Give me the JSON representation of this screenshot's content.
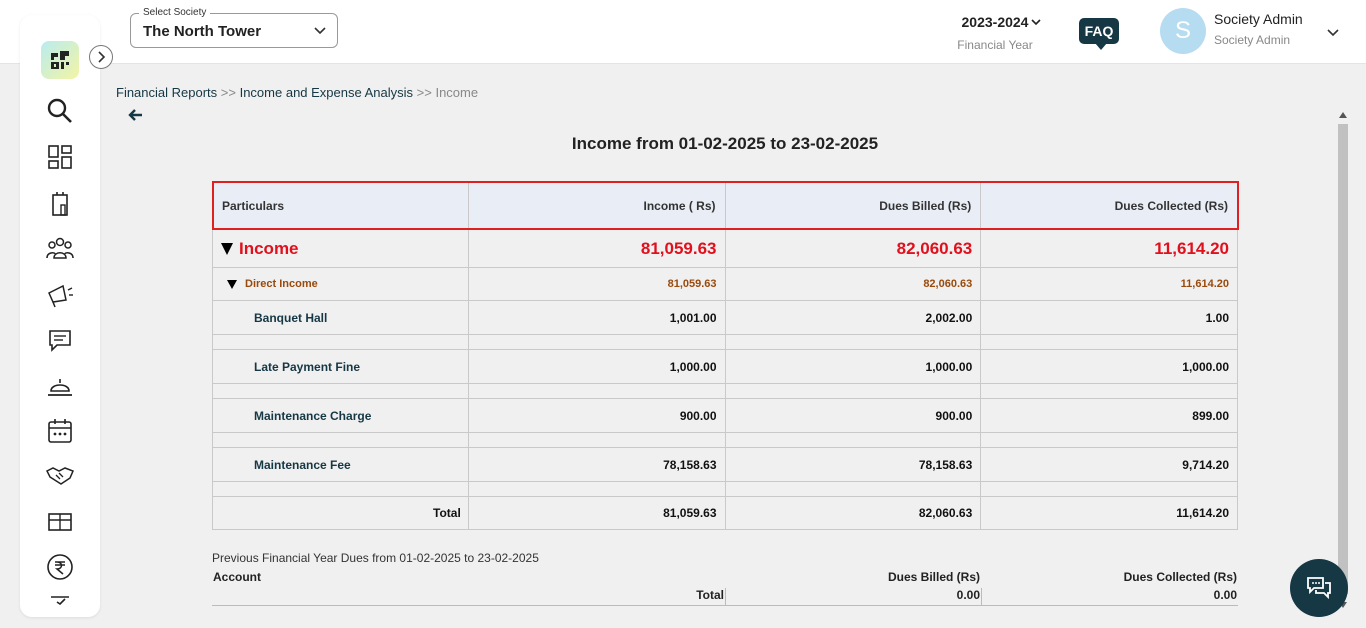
{
  "header": {
    "society_label": "Select Society",
    "society_value": "The North Tower",
    "fy_year": "2023-2024",
    "fy_label": "Financial Year",
    "faq": "FAQ",
    "avatar_letter": "S",
    "user_name": "Society Admin",
    "user_role": "Society Admin"
  },
  "sidebar": {
    "icons": [
      "search-icon",
      "dashboard-icon",
      "building-icon",
      "members-icon",
      "megaphone-icon",
      "chat-icon",
      "service-bell-icon",
      "calendar-icon",
      "handshake-icon",
      "amenities-icon",
      "rupee-icon",
      "checklist-icon"
    ]
  },
  "breadcrumb": {
    "item1": "Financial Reports",
    "sep1": ">>",
    "item2": "Income and Expense Analysis",
    "sep2": ">>",
    "current": "Income"
  },
  "report": {
    "title": "Income from 01-02-2025 to 23-02-2025",
    "columns": [
      "Particulars",
      "Income ( Rs)",
      "Dues Billed (Rs)",
      "Dues Collected (Rs)"
    ],
    "group": {
      "label": "Income",
      "income": "81,059.63",
      "billed": "82,060.63",
      "collected": "11,614.20"
    },
    "subgroup": {
      "label": "Direct Income",
      "income": "81,059.63",
      "billed": "82,060.63",
      "collected": "11,614.20"
    },
    "items": [
      {
        "label": "Banquet Hall",
        "income": "1,001.00",
        "billed": "2,002.00",
        "collected": "1.00"
      },
      {
        "label": "Late Payment Fine",
        "income": "1,000.00",
        "billed": "1,000.00",
        "collected": "1,000.00"
      },
      {
        "label": "Maintenance Charge",
        "income": "900.00",
        "billed": "900.00",
        "collected": "899.00"
      },
      {
        "label": "Maintenance Fee",
        "income": "78,158.63",
        "billed": "78,158.63",
        "collected": "9,714.20"
      }
    ],
    "total": {
      "label": "Total",
      "income": "81,059.63",
      "billed": "82,060.63",
      "collected": "11,614.20"
    }
  },
  "previous": {
    "title": "Previous Financial Year Dues from 01-02-2025 to 23-02-2025",
    "col_account": "Account",
    "col_billed": "Dues Billed (Rs)",
    "col_collected": "Dues Collected (Rs)",
    "total_label": "Total",
    "total_billed": "0.00",
    "total_collected": "0.00"
  },
  "colors": {
    "primary": "#163744",
    "income_red": "#e0101d",
    "direct_brown": "#9a4a0c",
    "header_bg": "#e8edf6",
    "highlight": "#e02020"
  }
}
